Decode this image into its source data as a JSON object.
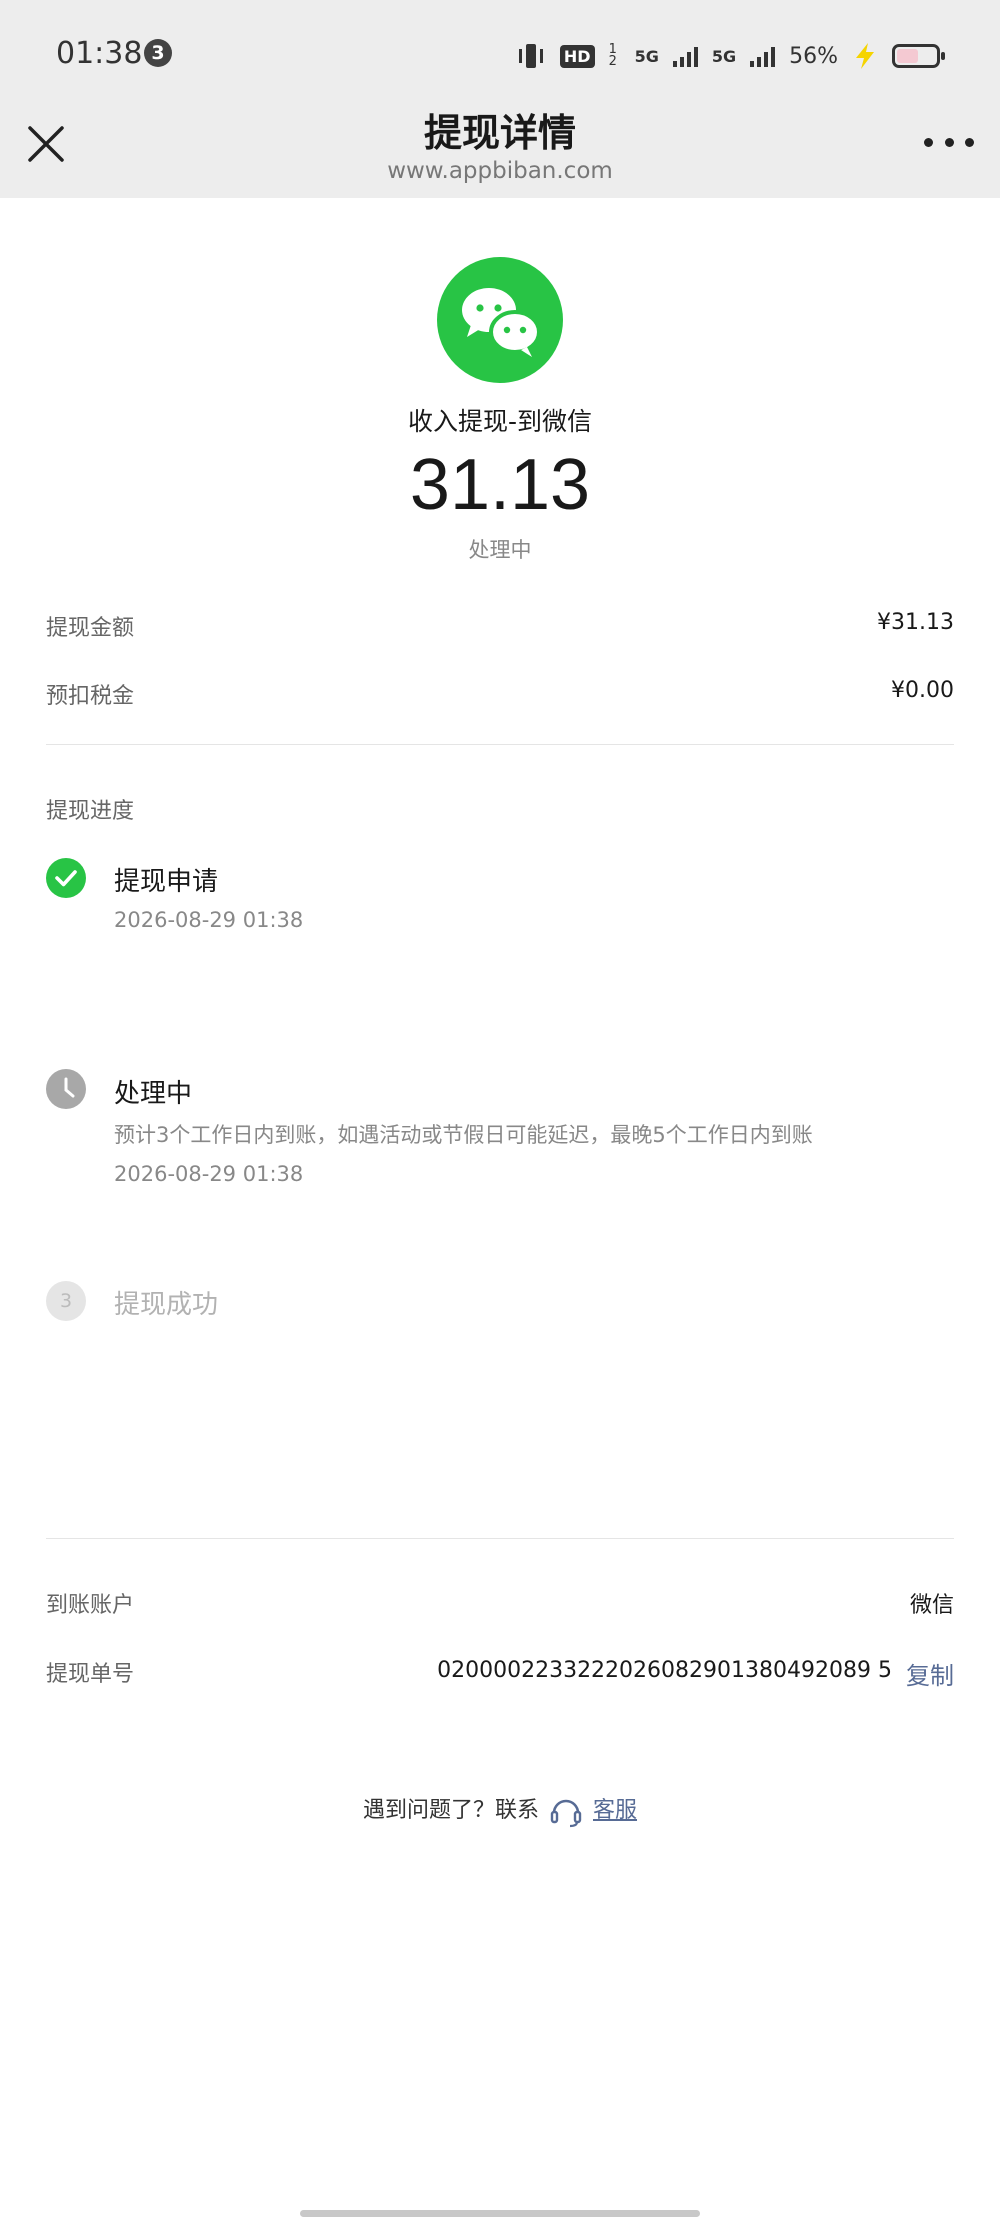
{
  "status_bar": {
    "time": "01:38",
    "notification_count": "3",
    "hd_label": "HD",
    "hd_sub": "1 2",
    "network_1": "5G",
    "network_2": "5G",
    "battery_percent": "56%",
    "battery_level": 0.56
  },
  "nav": {
    "title": "提现详情",
    "url": "www.appbiban.com"
  },
  "hero": {
    "type": "收入提现-到微信",
    "amount": "31.13",
    "status": "处理中",
    "brand_color": "#28c445"
  },
  "summary": {
    "withdraw_label": "提现金额",
    "withdraw_value": "¥31.13",
    "tax_label": "预扣税金",
    "tax_value": "¥0.00"
  },
  "progress": {
    "title": "提现进度",
    "steps": [
      {
        "title": "提现申请",
        "time": "2026-08-29 01:38",
        "state": "done"
      },
      {
        "title": "处理中",
        "desc": "预计3个工作日内到账，如遇活动或节假日可能延迟，最晚5个工作日内到账",
        "time": "2026-08-29 01:38",
        "state": "active"
      },
      {
        "index": "3",
        "title": "提现成功",
        "state": "pending"
      }
    ]
  },
  "details": {
    "account_label": "到账账户",
    "account_value": "微信",
    "order_label": "提现单号",
    "order_value": "0200002233222026082901380492089 5",
    "copy_label": "复制"
  },
  "help": {
    "text": "遇到问题了？联系",
    "link": "客服"
  },
  "colors": {
    "link": "#576b95",
    "success": "#28c445",
    "header_bg": "#ededed"
  }
}
